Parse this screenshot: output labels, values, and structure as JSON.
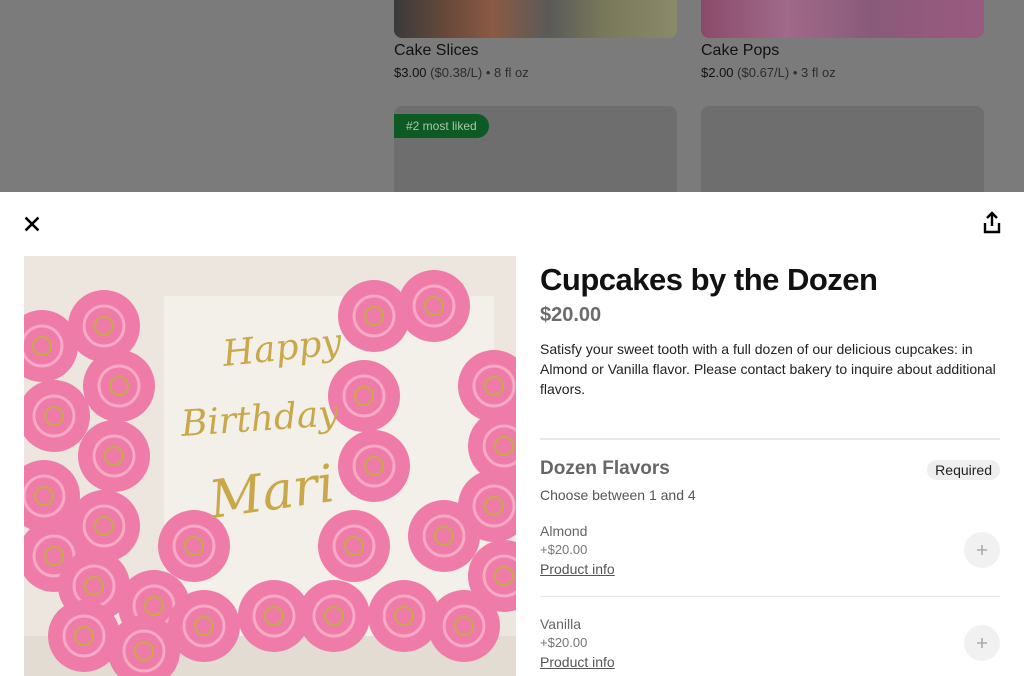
{
  "background": {
    "cards": [
      {
        "title": "Cake Slices",
        "price": "$3.00",
        "unit_price": "($0.38/L)",
        "size": "• 8 fl oz"
      },
      {
        "title": "Cake Pops",
        "price": "$2.00",
        "unit_price": "($0.67/L)",
        "size": "• 3 fl oz"
      }
    ],
    "badge": "#2 most liked"
  },
  "modal": {
    "close_icon": "close-icon",
    "share_icon": "share-icon",
    "image_alt": "Pink cupcakes arranged with Happy Birthday Mari sign",
    "image_text": [
      "Happy",
      "Birthday",
      "Mari"
    ],
    "title": "Cupcakes by the Dozen",
    "price": "$20.00",
    "description": "Satisfy your sweet tooth with a full dozen of our delicious cupcakes: in Almond or Vanilla flavor. Please contact bakery to inquire about additional flavors.",
    "section": {
      "title": "Dozen Flavors",
      "badge": "Required",
      "subtitle": "Choose between 1 and 4"
    },
    "options": [
      {
        "name": "Almond",
        "price": "+$20.00",
        "info": "Product info"
      },
      {
        "name": "Vanilla",
        "price": "+$20.00",
        "info": "Product info"
      }
    ]
  },
  "colors": {
    "badge_green": "#0d5a24",
    "cupcake_pink": "#f07aa6"
  }
}
